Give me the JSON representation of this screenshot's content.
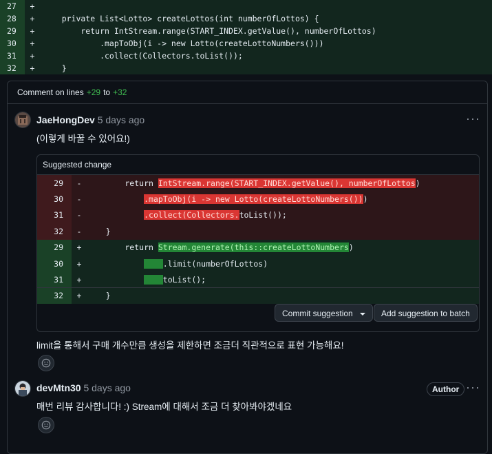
{
  "top_diff": [
    {
      "num": "27",
      "sign": "+",
      "code": ""
    },
    {
      "num": "28",
      "sign": "+",
      "code": "    private List<Lotto> createLottos(int numberOfLottos) {"
    },
    {
      "num": "29",
      "sign": "+",
      "code": "        return IntStream.range(START_INDEX.getValue(), numberOfLottos)"
    },
    {
      "num": "30",
      "sign": "+",
      "code": "            .mapToObj(i -> new Lotto(createLottoNumbers()))"
    },
    {
      "num": "31",
      "sign": "+",
      "code": "            .collect(Collectors.toList());"
    },
    {
      "num": "32",
      "sign": "+",
      "code": "    }"
    }
  ],
  "thread": {
    "header_prefix": "Comment on lines",
    "range_start": "+29",
    "to": "to",
    "range_end": "+32"
  },
  "comment1": {
    "author": "JaeHongDev",
    "time": "5 days ago",
    "text": "(이렇게 바꿀 수 있어요!)",
    "more": "···",
    "after_text": "limit을 통해서 구매 개수만큼 생성을 제한하면 조금더 직관적으로 표현 가능해요!"
  },
  "suggestion": {
    "title": "Suggested change",
    "deleted": [
      {
        "num": "29",
        "sign": "-",
        "pre": "        return ",
        "hl": "IntStream.range(START_INDEX.getValue(), numberOfLottos",
        "post": ")"
      },
      {
        "num": "30",
        "sign": "-",
        "pre": "            ",
        "hl": ".mapToObj(i -> new Lotto(createLottoNumbers())",
        "post": ")"
      },
      {
        "num": "31",
        "sign": "-",
        "pre": "            ",
        "hl": ".collect(Collectors.",
        "post": "toList());"
      },
      {
        "num": "32",
        "sign": "-",
        "pre": "    }",
        "hl": "",
        "post": ""
      }
    ],
    "added": [
      {
        "num": "29",
        "sign": "+",
        "pre": "        return ",
        "hl": "Stream.generate(this::createLottoNumbers",
        "post": ")"
      },
      {
        "num": "30",
        "sign": "+",
        "pre": "            ",
        "hl": "    ",
        "post": ".limit(numberOfLottos)"
      },
      {
        "num": "31",
        "sign": "+",
        "pre": "            ",
        "hl": "    ",
        "post": "toList();"
      },
      {
        "num": "32",
        "sign": "+",
        "pre": "    }",
        "hl": "",
        "post": ""
      }
    ],
    "commit_label": "Commit suggestion",
    "batch_label": "Add suggestion to batch"
  },
  "comment2": {
    "author": "devMtn30",
    "time": "5 days ago",
    "badge": "Author",
    "text": "매번 리뷰 감사합니다! :) Stream에 대해서 조금 더 찾아봐야겠네요",
    "more": "···"
  },
  "colors": {
    "add_bg": "#12261e",
    "del_bg": "#2d1619",
    "accent_green": "#3fb950"
  }
}
